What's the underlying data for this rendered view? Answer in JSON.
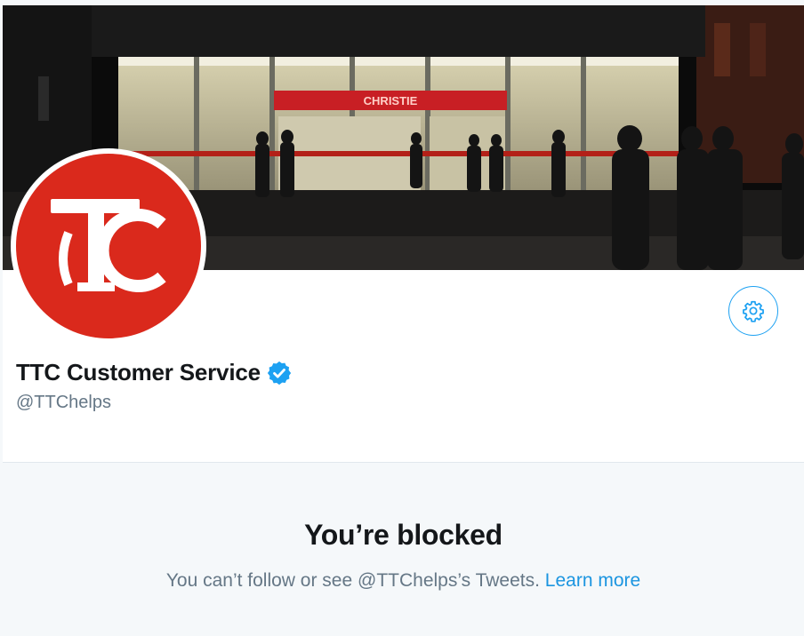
{
  "banner": {
    "station_sign": "CHRISTIE"
  },
  "avatar": {
    "logo_text": "TTC",
    "brand_color": "#da291c"
  },
  "profile": {
    "display_name": "TTC Customer Service",
    "verified": true,
    "handle": "@TTChelps"
  },
  "settings_button": {
    "icon": "gear-icon",
    "accent_color": "#1da1f2"
  },
  "blocked": {
    "title": "You’re blocked",
    "message": "You can’t follow or see @TTChelps’s Tweets.",
    "link_label": "Learn more"
  }
}
